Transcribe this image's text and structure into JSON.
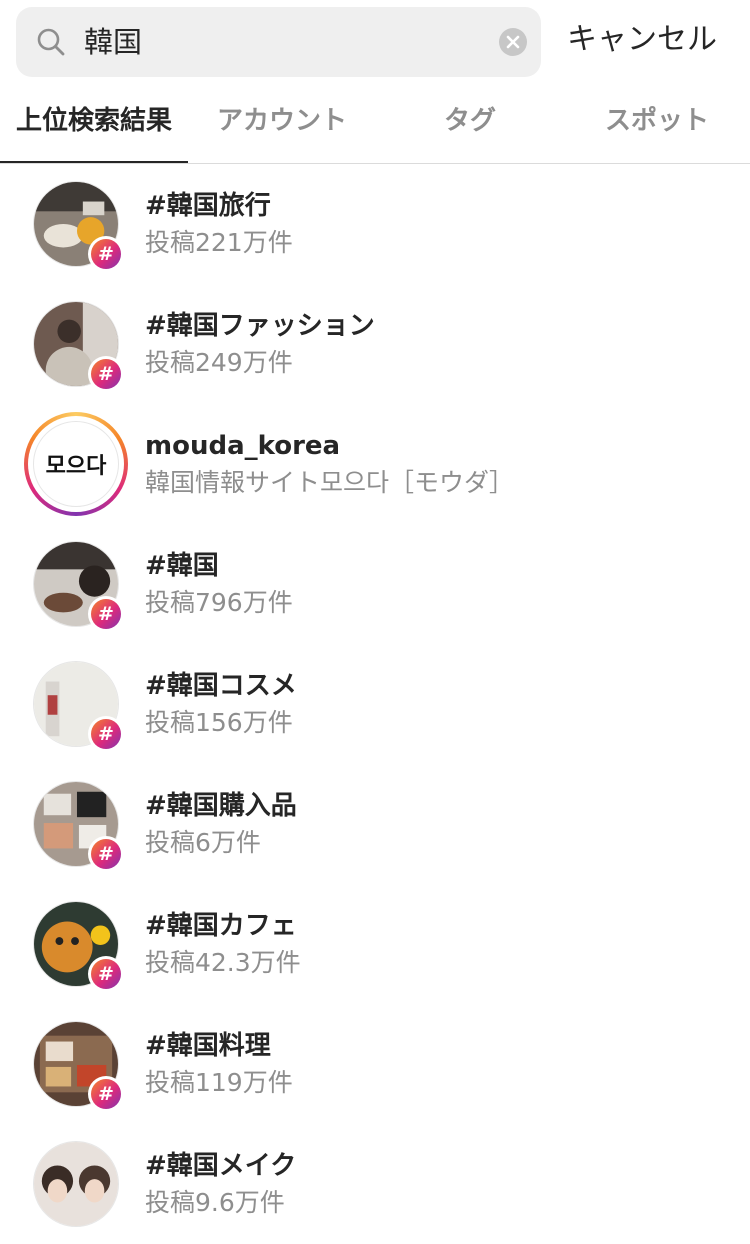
{
  "search": {
    "value": "韓国",
    "cancel_label": "キャンセル"
  },
  "tabs": [
    {
      "label": "上位検索結果",
      "active": true
    },
    {
      "label": "アカウント",
      "active": false
    },
    {
      "label": "タグ",
      "active": false
    },
    {
      "label": "スポット",
      "active": false
    }
  ],
  "results": [
    {
      "type": "hashtag",
      "title": "#韓国旅行",
      "subtitle": "投稿221万件"
    },
    {
      "type": "hashtag",
      "title": "#韓国ファッション",
      "subtitle": "投稿249万件"
    },
    {
      "type": "account",
      "title": "mouda_korea",
      "subtitle": "韓国情報サイト모으다［モウダ］",
      "logo_text": "모으다"
    },
    {
      "type": "hashtag",
      "title": "#韓国",
      "subtitle": "投稿796万件"
    },
    {
      "type": "hashtag",
      "title": "#韓国コスメ",
      "subtitle": "投稿156万件"
    },
    {
      "type": "hashtag",
      "title": "#韓国購入品",
      "subtitle": "投稿6万件"
    },
    {
      "type": "hashtag",
      "title": "#韓国カフェ",
      "subtitle": "投稿42.3万件"
    },
    {
      "type": "hashtag",
      "title": "#韓国料理",
      "subtitle": "投稿119万件"
    },
    {
      "type": "hashtag",
      "title": "#韓国メイク",
      "subtitle": "投稿9.6万件"
    }
  ],
  "hash_symbol": "#",
  "colors": {
    "accent_gradient_start": "#f58529",
    "accent_gradient_mid": "#dd2a7b",
    "accent_gradient_end": "#8134af",
    "text_primary": "#262626",
    "text_secondary": "#8e8e8e"
  }
}
